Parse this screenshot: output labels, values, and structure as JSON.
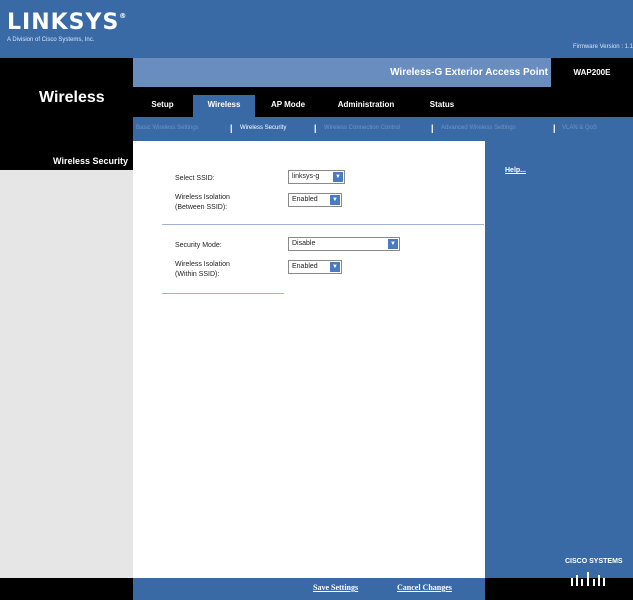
{
  "brand": {
    "logo": "LINKSYS",
    "logo_mark": "®",
    "tagline": "A Division of Cisco Systems, Inc.",
    "firmware": "Firmware Version : 1.1"
  },
  "section": {
    "title": "Wireless"
  },
  "product": {
    "name": "Wireless-G Exterior Access Point",
    "model": "WAP200E"
  },
  "tabs": [
    {
      "label": "Setup"
    },
    {
      "label": "Wireless"
    },
    {
      "label": "AP Mode"
    },
    {
      "label": "Administration"
    },
    {
      "label": "Status"
    }
  ],
  "active_tab": "Wireless",
  "subtabs": [
    {
      "label": "Basic Wireless Settings"
    },
    {
      "label": "Wireless Security"
    },
    {
      "label": "Wireless Connection Control"
    },
    {
      "label": "Advanced Wireless Settings"
    },
    {
      "label": "VLAN & QoS"
    }
  ],
  "active_subtab": "Wireless Security",
  "separator": "|",
  "sidebar": {
    "heading": "Wireless Security"
  },
  "form": {
    "select_ssid_label": "Select SSID:",
    "select_ssid_value": "linksys-g",
    "isolation_between_label_1": "Wireless Isolation",
    "isolation_between_label_2": "(Between SSID):",
    "isolation_between_value": "Enabled",
    "security_mode_label": "Security Mode:",
    "security_mode_value": "Disable",
    "isolation_within_label_1": "Wireless Isolation",
    "isolation_within_label_2": "(Within SSID):",
    "isolation_within_value": "Enabled"
  },
  "help": {
    "label": "Help..."
  },
  "footer": {
    "save": "Save Settings",
    "cancel": "Cancel Changes"
  },
  "cisco": {
    "label": "CISCO SYSTEMS"
  },
  "icons": {
    "dropdown": "chevron-down-icon",
    "cisco_logo": "cisco-bridge-logo"
  },
  "colors": {
    "brand_blue": "#3a6aa6",
    "light_blue": "#6a8dc0",
    "dim_link": "#6f93c6",
    "left_grey": "#e6e6e6"
  }
}
